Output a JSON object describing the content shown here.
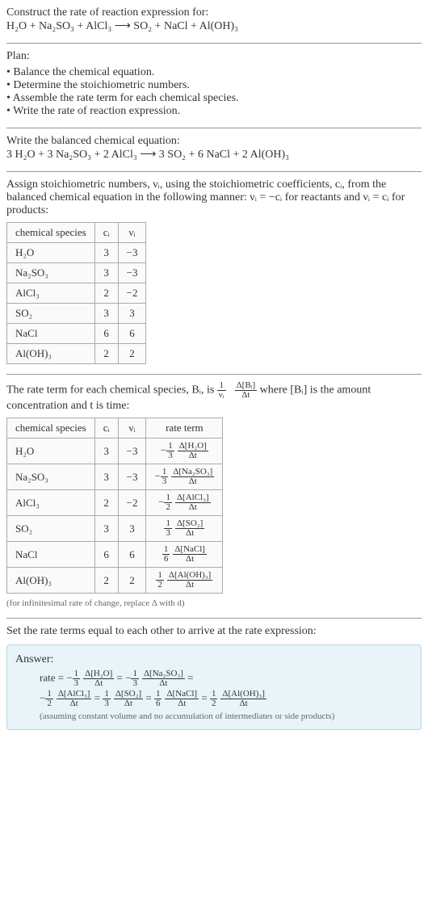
{
  "header": {
    "title": "Construct the rate of reaction expression for:",
    "equation": "H₂O + Na₂SO₃ + AlCl₃ ⟶ SO₂ + NaCl + Al(OH)₃"
  },
  "plan": {
    "title": "Plan:",
    "items": [
      "Balance the chemical equation.",
      "Determine the stoichiometric numbers.",
      "Assemble the rate term for each chemical species.",
      "Write the rate of reaction expression."
    ]
  },
  "balanced": {
    "title": "Write the balanced chemical equation:",
    "equation": "3 H₂O + 3 Na₂SO₃ + 2 AlCl₃ ⟶ 3 SO₂ + 6 NaCl + 2 Al(OH)₃"
  },
  "stoich_intro": "Assign stoichiometric numbers, νᵢ, using the stoichiometric coefficients, cᵢ, from the balanced chemical equation in the following manner: νᵢ = −cᵢ for reactants and νᵢ = cᵢ for products:",
  "table1": {
    "headers": [
      "chemical species",
      "cᵢ",
      "νᵢ"
    ],
    "rows": [
      [
        "H₂O",
        "3",
        "−3"
      ],
      [
        "Na₂SO₃",
        "3",
        "−3"
      ],
      [
        "AlCl₃",
        "2",
        "−2"
      ],
      [
        "SO₂",
        "3",
        "3"
      ],
      [
        "NaCl",
        "6",
        "6"
      ],
      [
        "Al(OH)₃",
        "2",
        "2"
      ]
    ]
  },
  "rate_intro_1": "The rate term for each chemical species, Bᵢ, is ",
  "rate_intro_frac_pre": "1",
  "rate_intro_frac_den1": "νᵢ",
  "rate_intro_frac_num2": "Δ[Bᵢ]",
  "rate_intro_frac_den2": "Δt",
  "rate_intro_2": " where [Bᵢ] is the amount concentration and t is time:",
  "table2": {
    "headers": [
      "chemical species",
      "cᵢ",
      "νᵢ",
      "rate term"
    ],
    "rows": [
      {
        "sp": "H₂O",
        "c": "3",
        "v": "−3",
        "sign": "−",
        "coef_num": "1",
        "coef_den": "3",
        "delta": "Δ[H₂O]"
      },
      {
        "sp": "Na₂SO₃",
        "c": "3",
        "v": "−3",
        "sign": "−",
        "coef_num": "1",
        "coef_den": "3",
        "delta": "Δ[Na₂SO₃]"
      },
      {
        "sp": "AlCl₃",
        "c": "2",
        "v": "−2",
        "sign": "−",
        "coef_num": "1",
        "coef_den": "2",
        "delta": "Δ[AlCl₃]"
      },
      {
        "sp": "SO₂",
        "c": "3",
        "v": "3",
        "sign": "",
        "coef_num": "1",
        "coef_den": "3",
        "delta": "Δ[SO₂]"
      },
      {
        "sp": "NaCl",
        "c": "6",
        "v": "6",
        "sign": "",
        "coef_num": "1",
        "coef_den": "6",
        "delta": "Δ[NaCl]"
      },
      {
        "sp": "Al(OH)₃",
        "c": "2",
        "v": "2",
        "sign": "",
        "coef_num": "1",
        "coef_den": "2",
        "delta": "Δ[Al(OH)₃]"
      }
    ]
  },
  "note1": "(for infinitesimal rate of change, replace Δ with d)",
  "final_intro": "Set the rate terms equal to each other to arrive at the rate expression:",
  "answer": {
    "title": "Answer:",
    "rate_label": "rate = ",
    "terms": [
      {
        "sign": "−",
        "coef_num": "1",
        "coef_den": "3",
        "delta": "Δ[H₂O]"
      },
      {
        "sign": "−",
        "coef_num": "1",
        "coef_den": "3",
        "delta": "Δ[Na₂SO₃]"
      },
      {
        "sign": "−",
        "coef_num": "1",
        "coef_den": "2",
        "delta": "Δ[AlCl₃]"
      },
      {
        "sign": "",
        "coef_num": "1",
        "coef_den": "3",
        "delta": "Δ[SO₂]"
      },
      {
        "sign": "",
        "coef_num": "1",
        "coef_den": "6",
        "delta": "Δ[NaCl]"
      },
      {
        "sign": "",
        "coef_num": "1",
        "coef_den": "2",
        "delta": "Δ[Al(OH)₃]"
      }
    ],
    "note": "(assuming constant volume and no accumulation of intermediates or side products)"
  },
  "chart_data": {
    "type": "table",
    "title": "Stoichiometric and rate data for H₂O + Na₂SO₃ + AlCl₃ → SO₂ + NaCl + Al(OH)₃",
    "columns": [
      "chemical species",
      "cᵢ",
      "νᵢ",
      "rate term"
    ],
    "rows": [
      [
        "H₂O",
        3,
        -3,
        "-(1/3) Δ[H₂O]/Δt"
      ],
      [
        "Na₂SO₃",
        3,
        -3,
        "-(1/3) Δ[Na₂SO₃]/Δt"
      ],
      [
        "AlCl₃",
        2,
        -2,
        "-(1/2) Δ[AlCl₃]/Δt"
      ],
      [
        "SO₂",
        3,
        3,
        "(1/3) Δ[SO₂]/Δt"
      ],
      [
        "NaCl",
        6,
        6,
        "(1/6) Δ[NaCl]/Δt"
      ],
      [
        "Al(OH)₃",
        2,
        2,
        "(1/2) Δ[Al(OH)₃]/Δt"
      ]
    ],
    "balanced_equation": "3 H₂O + 3 Na₂SO₃ + 2 AlCl₃ → 3 SO₂ + 6 NaCl + 2 Al(OH)₃",
    "rate_expression": "rate = -(1/3)Δ[H₂O]/Δt = -(1/3)Δ[Na₂SO₃]/Δt = -(1/2)Δ[AlCl₃]/Δt = (1/3)Δ[SO₂]/Δt = (1/6)Δ[NaCl]/Δt = (1/2)Δ[Al(OH)₃]/Δt"
  }
}
